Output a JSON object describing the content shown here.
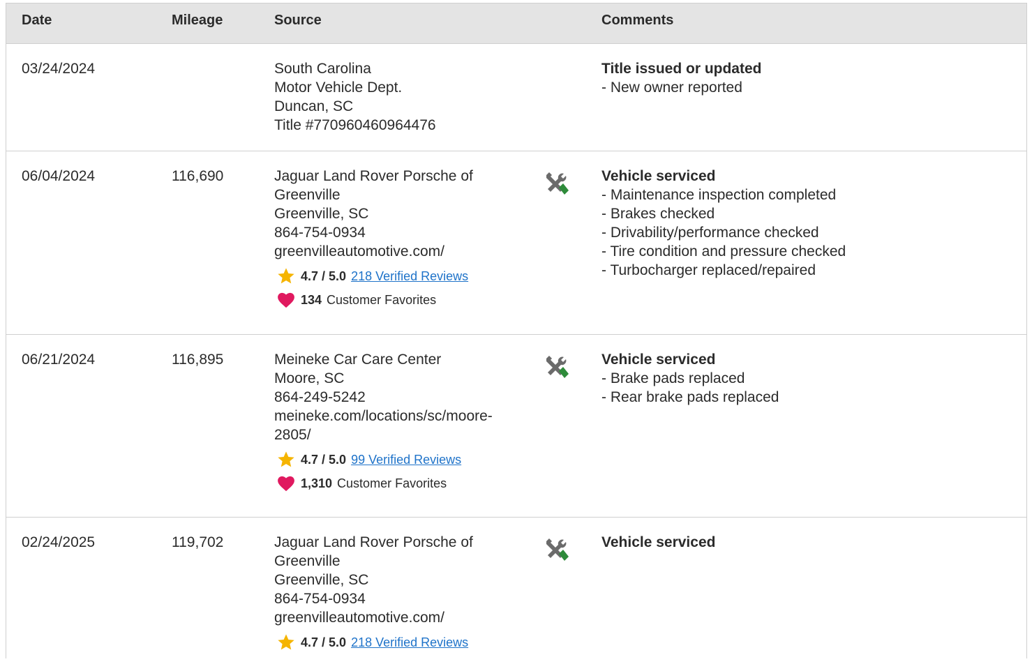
{
  "table": {
    "headers": {
      "date": "Date",
      "mileage": "Mileage",
      "source": "Source",
      "comments": "Comments"
    },
    "rows": [
      {
        "date": "03/24/2024",
        "mileage": "",
        "source": [
          "South Carolina",
          "Motor Vehicle Dept.",
          "Duncan, SC",
          "Title #770960460964476"
        ],
        "comment_title": "Title issued or updated",
        "comment_items": [
          "- New owner reported"
        ]
      },
      {
        "date": "06/04/2024",
        "mileage": "116,690",
        "source": [
          "Jaguar Land Rover Porsche of",
          "Greenville",
          "Greenville, SC",
          "864-754-0934",
          "greenvilleautomotive.com/"
        ],
        "rating": "4.7 / 5.0",
        "reviews": "218 Verified Reviews",
        "favorites_count": "134",
        "favorites_label": "Customer Favorites",
        "comment_title": "Vehicle serviced",
        "comment_items": [
          "- Maintenance inspection completed",
          "- Brakes checked",
          "- Drivability/performance checked",
          "- Tire condition and pressure checked",
          "- Turbocharger replaced/repaired"
        ]
      },
      {
        "date": "06/21/2024",
        "mileage": "116,895",
        "source": [
          "Meineke Car Care Center",
          "Moore, SC",
          "864-249-5242",
          "meineke.com/locations/sc/moore-",
          "2805/"
        ],
        "rating": "4.7 / 5.0",
        "reviews": "99 Verified Reviews",
        "favorites_count": "1,310",
        "favorites_label": "Customer Favorites",
        "comment_title": "Vehicle serviced",
        "comment_items": [
          "- Brake pads replaced",
          "- Rear brake pads replaced"
        ]
      },
      {
        "date": "02/24/2025",
        "mileage": "119,702",
        "source": [
          "Jaguar Land Rover Porsche of",
          "Greenville",
          "Greenville, SC",
          "864-754-0934",
          "greenvilleautomotive.com/"
        ],
        "rating": "4.7 / 5.0",
        "reviews": "218 Verified Reviews",
        "comment_title": "Vehicle serviced",
        "comment_items": []
      }
    ]
  },
  "icons": {
    "service": "wrench-screwdriver-icon",
    "rating": "star-icon",
    "favorite": "heart-icon"
  },
  "colors": {
    "header_bg": "#e4e4e4",
    "link": "#1f73c9",
    "star": "#f5b400",
    "heart": "#e0195f",
    "service_icon_green": "#2e8b3a",
    "service_icon_gray": "#6b6b6b"
  }
}
